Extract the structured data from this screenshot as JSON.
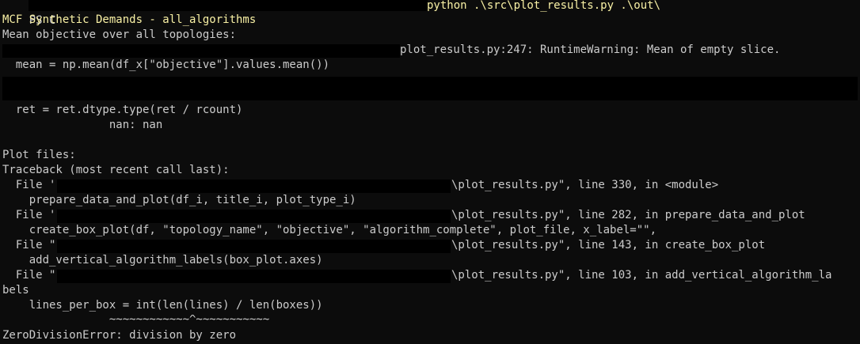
{
  "terminal": {
    "prompt_start": "PS C",
    "cmd_tail": "python .\\src\\plot_results.py .\\out\\",
    "title_line": "MCF Synthetic Demands - all_algorithms",
    "mean_header": "Mean objective over all topologies:",
    "warning1_text": "plot_results.py:247: RuntimeWarning: Mean of empty slice.",
    "mean_code": "  mean = np.mean(df_x[\"objective\"].values.mean())",
    "ret_code": "  ret = ret.dtype.type(ret / rcount)",
    "nan_line": "                nan: nan",
    "plot_files": "Plot files:",
    "traceback_header": "Traceback (most recent call last):",
    "frames": [
      {
        "file_prefix": "  File '",
        "file_suffix": "\\plot_results.py\", line 330, in <module>",
        "code": "    prepare_data_and_plot(df_i, title_i, plot_type_i)"
      },
      {
        "file_prefix": "  File '",
        "file_suffix": "\\plot_results.py\", line 282, in prepare_data_and_plot",
        "code": "    create_box_plot(df, \"topology_name\", \"objective\", \"algorithm_complete\", plot_file, x_label=\"\","
      },
      {
        "file_prefix": "  File \"",
        "file_suffix": "\\plot_results.py\", line 143, in create_box_plot",
        "code": "    add_vertical_algorithm_labels(box_plot.axes)"
      },
      {
        "file_prefix": "  File \"",
        "file_suffix": "\\plot_results.py\", line 103, in add_vertical_algorithm_la",
        "code": ""
      }
    ],
    "wrap_tail": "bels",
    "lines_code": "    lines_per_box = int(len(lines) / len(boxes))",
    "underline": "                ~~~~~~~~~~~~^~~~~~~~~~~~",
    "error_line": "ZeroDivisionError: division by zero"
  }
}
